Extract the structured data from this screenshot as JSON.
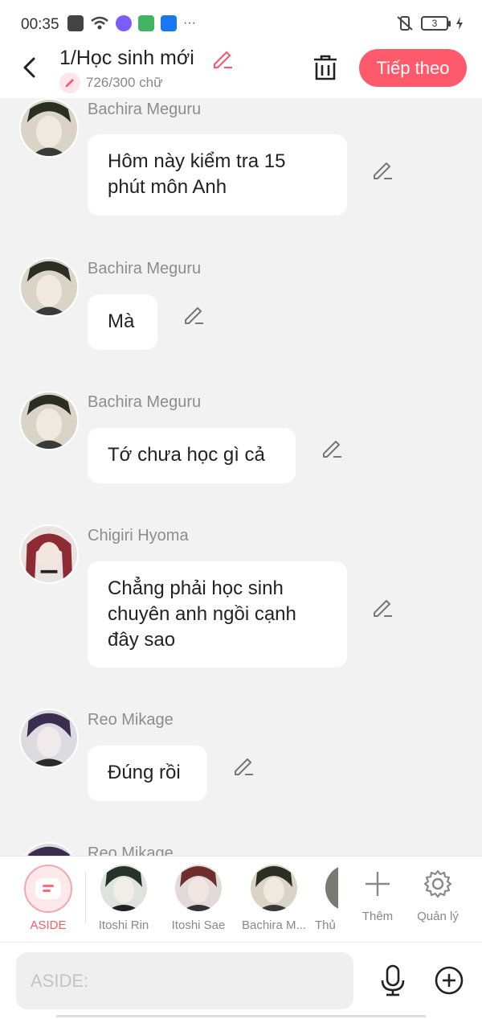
{
  "status_bar": {
    "time": "00:35",
    "battery": "3"
  },
  "header": {
    "title": "1/Học sinh mới",
    "word_count": "726/300 chữ",
    "next_label": "Tiếp theo"
  },
  "messages": [
    {
      "name": "Bachira Meguru",
      "text": "Hôm này kiểm tra 15 phút môn Anh"
    },
    {
      "name": "Bachira Meguru",
      "text": "Mà"
    },
    {
      "name": "Bachira Meguru",
      "text": "Tớ chưa học gì cả"
    },
    {
      "name": "Chigiri Hyoma",
      "text": "Chẳng phải học sinh chuyên anh ngồi cạnh đây sao"
    },
    {
      "name": "Reo Mikage",
      "text": "Đúng rồi"
    },
    {
      "name": "Reo Mikage",
      "text": ""
    }
  ],
  "character_bar": {
    "aside_label": "ASIDE",
    "characters": [
      "Itoshi Rin",
      "Itoshi Sae",
      "Bachira M...",
      "Thủ"
    ],
    "add_label": "Thêm",
    "manage_label": "Quản lý"
  },
  "input": {
    "placeholder": "ASIDE:"
  },
  "colors": {
    "accent": "#ff5a6c",
    "background": "#f2f2f2",
    "bubble": "#ffffff",
    "name_text": "#8d8d8d"
  },
  "icons": [
    "back-arrow-icon",
    "pencil-icon",
    "trash-icon",
    "microphone-icon",
    "plus-circle-icon",
    "plus-icon",
    "gear-icon",
    "chat-bubble-icon"
  ]
}
